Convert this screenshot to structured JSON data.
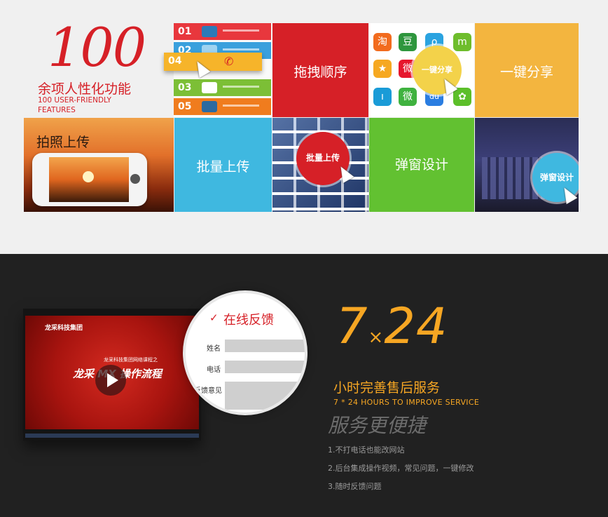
{
  "features": {
    "number": "100",
    "title_cn": "余项人性化功能",
    "title_en": "100 USER-FRIENDLY FEATURES"
  },
  "list_tile": {
    "rows": [
      {
        "num": "01",
        "color": "#e8373d"
      },
      {
        "num": "02",
        "color": "#3aa0dd"
      },
      {
        "num": "04",
        "color": "#f6b42a"
      },
      {
        "num": "03",
        "color": "#7cbf36"
      },
      {
        "num": "05",
        "color": "#f07c1e"
      }
    ]
  },
  "tiles": {
    "drag_order": "拖拽顺序",
    "share_badge": "一键分享",
    "share": "一键分享",
    "photo_upload": "拍照上传",
    "batch_upload": "批量上传",
    "batch_badge": "批量上传",
    "popup_design": "弹窗设计",
    "popup_badge": "弹窗设计"
  },
  "social_icons": [
    {
      "glyph": "淘",
      "color": "#f26b1d"
    },
    {
      "glyph": "豆",
      "color": "#2e963d"
    },
    {
      "glyph": "ρ",
      "color": "#2aa3e0"
    },
    {
      "glyph": "m",
      "color": "#6ebd2c"
    },
    {
      "glyph": "★",
      "color": "#f6a821"
    },
    {
      "glyph": "微",
      "color": "#e6162d"
    },
    {
      "glyph": "ı",
      "color": "#1a9bd7"
    },
    {
      "glyph": "微",
      "color": "#3fb23f"
    },
    {
      "glyph": "du",
      "color": "#2a7de1"
    },
    {
      "glyph": "✿",
      "color": "#5cbf2a"
    }
  ],
  "player": {
    "brand": "龙采科技集团",
    "title": "龙采 MX 操作流程",
    "subtitle": "龙采科技集团网络课程之"
  },
  "feedback": {
    "title": "在线反馈",
    "name_label": "姓名",
    "phone_label": "电话",
    "comment_label": "反馈意见"
  },
  "service": {
    "big": "7",
    "times": "×",
    "big2": "24",
    "title_cn": "小时完善售后服务",
    "title_en": "7 * 24 HOURS TO IMPROVE SERVICE",
    "slogan": "服务更便捷",
    "items": [
      "1.不打电话也能改网站",
      "2.后台集成操作视频，常见问题，一键修改",
      "3.随时反馈问题"
    ]
  },
  "colors": {
    "red": "#d62027",
    "yellow": "#f3b53f",
    "blue": "#3fb8e0",
    "green": "#62c131",
    "orange": "#f6a623"
  }
}
